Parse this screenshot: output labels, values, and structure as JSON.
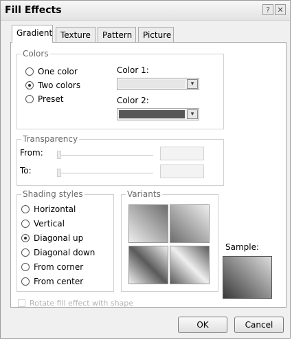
{
  "window": {
    "title": "Fill Effects",
    "help_glyph": "?",
    "close_glyph": "✕"
  },
  "tabs": [
    {
      "label": "Gradient",
      "active": true
    },
    {
      "label": "Texture"
    },
    {
      "label": "Pattern"
    },
    {
      "label": "Picture"
    }
  ],
  "colors": {
    "legend": "Colors",
    "options": [
      {
        "label": "One color",
        "selected": false
      },
      {
        "label": "Two colors",
        "selected": true
      },
      {
        "label": "Preset",
        "selected": false
      }
    ],
    "color1": {
      "label": "Color 1:",
      "swatch": "#e6e6e6"
    },
    "color2": {
      "label": "Color 2:",
      "swatch": "#575757"
    }
  },
  "transparency": {
    "legend": "Transparency",
    "from_label": "From:",
    "to_label": "To:"
  },
  "shading": {
    "legend": "Shading styles",
    "options": [
      {
        "label": "Horizontal",
        "selected": false
      },
      {
        "label": "Vertical",
        "selected": false
      },
      {
        "label": "Diagonal up",
        "selected": true
      },
      {
        "label": "Diagonal down",
        "selected": false
      },
      {
        "label": "From corner",
        "selected": false
      },
      {
        "label": "From center",
        "selected": false
      }
    ]
  },
  "variants": {
    "legend": "Variants"
  },
  "sample": {
    "label": "Sample:"
  },
  "rotate_checkbox": {
    "label": "Rotate fill effect with shape",
    "enabled": false
  },
  "buttons": {
    "ok": "OK",
    "cancel": "Cancel"
  },
  "colors_accent": {
    "panel_border": "#aaaaaa",
    "legend_text": "#6a6a6a"
  }
}
